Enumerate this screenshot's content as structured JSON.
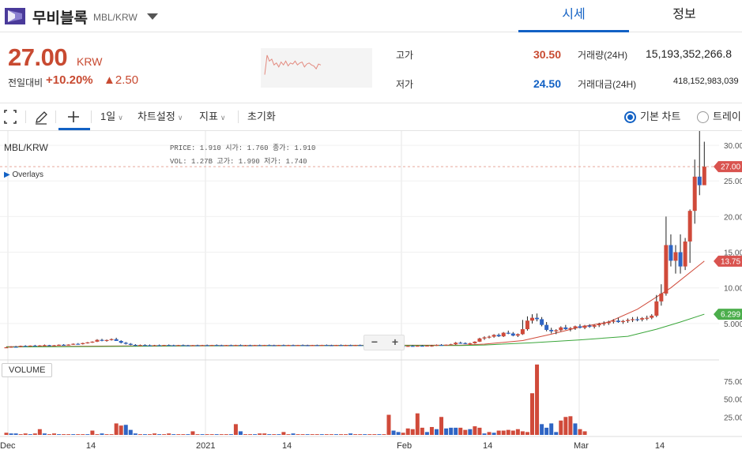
{
  "header": {
    "coin_name": "무비블록",
    "coin_pair": "MBL/KRW",
    "tabs": [
      {
        "label": "시세",
        "active": true
      },
      {
        "label": "정보",
        "active": false
      }
    ]
  },
  "summary": {
    "price": "27.00",
    "price_unit": "KRW",
    "change_label": "전일대비",
    "change_pct": "+10.20%",
    "change_amount": "▲2.50",
    "high_label": "고가",
    "high_value": "30.50",
    "low_label": "저가",
    "low_value": "24.50",
    "volume_label": "거래량(24H)",
    "volume_value": "15,193,352,266.8",
    "amount_label": "거래대금(24H)",
    "amount_value": "418,152,983,039"
  },
  "toolbar": {
    "interval": "1일",
    "chart_settings": "차트설정",
    "indicators": "지표",
    "reset": "초기화",
    "basic_chart": "기본 차트",
    "tradingview": "트레이"
  },
  "chart": {
    "symbol": "MBL/KRW",
    "ohlc_line1": "PRICE: 1.910   시가: 1.760   종가: 1.910",
    "ohlc_line2": "VOL:  1.27B   고가: 1.990   저가: 1.740",
    "overlays_label": "Overlays",
    "volume_label": "VOLUME",
    "zoom_out": "−",
    "zoom_in": "+",
    "price_ticks": [
      "30.00",
      "25.00",
      "20.00",
      "15.00",
      "10.00",
      "5.000"
    ],
    "volume_ticks": [
      "75.00",
      "50.00",
      "25.00"
    ],
    "date_ticks": [
      "Dec",
      "14",
      "2021",
      "14",
      "Feb",
      "14",
      "Mar",
      "14"
    ],
    "last_price_tag": "27.00",
    "ma_red_tag": "13.75",
    "ma_green_tag": "6.299",
    "colors": {
      "up": "#d04a3a",
      "down": "#2f65c4",
      "ma_short": "#d04a3a",
      "ma_long": "#3aa63a",
      "accent": "#1261c4"
    }
  },
  "chart_data": {
    "type": "candlestick",
    "candles": [
      [
        1.6,
        1.7,
        1.55,
        1.66
      ],
      [
        1.66,
        1.8,
        1.6,
        1.74
      ],
      [
        1.74,
        1.85,
        1.7,
        1.7
      ],
      [
        1.7,
        1.9,
        1.68,
        1.86
      ],
      [
        1.86,
        1.95,
        1.78,
        1.8
      ],
      [
        1.8,
        1.92,
        1.75,
        1.9
      ],
      [
        1.9,
        2.0,
        1.82,
        1.84
      ],
      [
        1.84,
        1.96,
        1.8,
        1.92
      ],
      [
        1.92,
        2.05,
        1.88,
        1.96
      ],
      [
        1.96,
        2.0,
        1.85,
        1.88
      ],
      [
        1.88,
        1.98,
        1.82,
        1.94
      ],
      [
        1.94,
        2.06,
        1.9,
        2.02
      ],
      [
        2.02,
        2.1,
        1.95,
        1.98
      ],
      [
        1.98,
        2.08,
        1.92,
        2.05
      ],
      [
        2.05,
        2.2,
        2.0,
        2.15
      ],
      [
        2.15,
        2.25,
        2.05,
        2.1
      ],
      [
        2.1,
        2.3,
        2.05,
        2.25
      ],
      [
        2.25,
        2.4,
        2.18,
        2.35
      ],
      [
        2.35,
        2.5,
        2.28,
        2.45
      ],
      [
        2.45,
        2.8,
        2.4,
        2.7
      ],
      [
        2.7,
        2.85,
        2.5,
        2.6
      ],
      [
        2.6,
        2.75,
        2.45,
        2.68
      ],
      [
        2.68,
        2.9,
        2.6,
        2.8
      ],
      [
        2.8,
        3.0,
        2.6,
        2.55
      ],
      [
        2.55,
        2.65,
        2.2,
        2.3
      ],
      [
        2.3,
        2.4,
        2.05,
        2.15
      ],
      [
        2.15,
        2.25,
        1.95,
        2.0
      ],
      [
        2.0,
        2.1,
        1.85,
        1.92
      ],
      [
        1.92,
        2.05,
        1.85,
        1.98
      ],
      [
        1.98,
        2.08,
        1.9,
        1.95
      ],
      [
        1.95,
        2.05,
        1.88,
        1.9
      ],
      [
        1.9,
        2.0,
        1.82,
        1.96
      ],
      [
        1.96,
        2.05,
        1.9,
        1.92
      ],
      [
        1.92,
        2.0,
        1.85,
        1.98
      ],
      [
        1.98,
        2.06,
        1.92,
        1.95
      ],
      [
        1.95,
        2.02,
        1.88,
        1.93
      ],
      [
        1.93,
        2.0,
        1.86,
        1.97
      ],
      [
        1.97,
        2.05,
        1.9,
        1.94
      ],
      [
        1.94,
        2.0,
        1.86,
        1.9
      ],
      [
        1.9,
        1.98,
        1.84,
        1.95
      ],
      [
        1.95,
        2.02,
        1.88,
        1.92
      ],
      [
        1.92,
        2.0,
        1.85,
        1.96
      ],
      [
        1.96,
        2.04,
        1.9,
        1.93
      ],
      [
        1.93,
        2.0,
        1.86,
        1.98
      ],
      [
        1.98,
        2.06,
        1.92,
        1.95
      ],
      [
        1.95,
        2.02,
        1.88,
        1.91
      ],
      [
        1.91,
        1.99,
        1.85,
        1.96
      ],
      [
        1.96,
        2.03,
        1.9,
        1.94
      ],
      [
        1.94,
        2.01,
        1.87,
        1.97
      ],
      [
        1.97,
        2.05,
        1.91,
        1.93
      ],
      [
        1.93,
        2.0,
        1.86,
        1.95
      ],
      [
        1.95,
        2.02,
        1.89,
        1.92
      ],
      [
        1.92,
        2.0,
        1.85,
        1.96
      ],
      [
        1.96,
        2.03,
        1.9,
        1.94
      ],
      [
        1.94,
        2.0,
        1.86,
        1.98
      ],
      [
        1.98,
        2.05,
        1.92,
        1.95
      ],
      [
        1.95,
        2.02,
        1.88,
        1.93
      ],
      [
        1.93,
        2.0,
        1.86,
        1.97
      ],
      [
        1.97,
        2.04,
        1.9,
        1.94
      ],
      [
        1.94,
        2.01,
        1.87,
        1.96
      ],
      [
        1.96,
        2.03,
        1.9,
        1.93
      ],
      [
        1.93,
        2.0,
        1.86,
        1.97
      ],
      [
        1.97,
        2.05,
        1.91,
        1.95
      ],
      [
        1.95,
        2.02,
        1.88,
        1.92
      ],
      [
        1.92,
        2.0,
        1.85,
        1.96
      ],
      [
        1.96,
        2.03,
        1.9,
        1.94
      ],
      [
        1.94,
        2.01,
        1.87,
        1.98
      ],
      [
        1.98,
        2.05,
        1.92,
        1.95
      ],
      [
        1.95,
        2.02,
        1.88,
        1.93
      ],
      [
        1.93,
        2.0,
        1.86,
        1.97
      ],
      [
        1.97,
        2.05,
        1.91,
        1.94
      ],
      [
        1.94,
        2.01,
        1.87,
        1.96
      ],
      [
        1.96,
        2.03,
        1.9,
        1.93
      ],
      [
        1.93,
        2.0,
        1.86,
        1.97
      ],
      [
        1.97,
        2.04,
        1.9,
        1.95
      ],
      [
        1.95,
        2.02,
        1.88,
        1.92
      ],
      [
        1.92,
        2.0,
        1.85,
        1.96
      ],
      [
        1.96,
        2.03,
        1.9,
        1.94
      ],
      [
        1.94,
        2.01,
        1.87,
        1.9
      ],
      [
        1.9,
        1.98,
        1.84,
        1.86
      ],
      [
        1.86,
        1.94,
        1.8,
        1.82
      ],
      [
        1.82,
        1.9,
        1.76,
        1.88
      ],
      [
        1.88,
        1.96,
        1.82,
        1.85
      ],
      [
        1.85,
        1.92,
        1.78,
        1.8
      ],
      [
        1.8,
        1.88,
        1.74,
        1.86
      ],
      [
        1.86,
        1.94,
        1.8,
        1.83
      ],
      [
        1.83,
        1.9,
        1.76,
        1.88
      ],
      [
        1.88,
        1.96,
        1.82,
        1.84
      ],
      [
        1.84,
        1.92,
        1.78,
        1.9
      ],
      [
        1.9,
        1.99,
        1.74,
        1.91
      ],
      [
        1.91,
        2.05,
        1.85,
        2.0
      ],
      [
        2.0,
        2.1,
        1.92,
        1.96
      ],
      [
        1.96,
        2.05,
        1.88,
        2.02
      ],
      [
        2.02,
        2.15,
        1.96,
        2.08
      ],
      [
        2.08,
        2.4,
        2.0,
        2.3
      ],
      [
        2.3,
        2.45,
        2.15,
        2.25
      ],
      [
        2.25,
        2.35,
        2.1,
        2.15
      ],
      [
        2.15,
        2.3,
        2.05,
        2.22
      ],
      [
        2.22,
        2.5,
        2.15,
        2.45
      ],
      [
        2.45,
        3.0,
        2.4,
        2.9
      ],
      [
        2.9,
        3.2,
        2.7,
        3.05
      ],
      [
        3.05,
        3.3,
        2.9,
        3.15
      ],
      [
        3.15,
        3.5,
        3.0,
        3.4
      ],
      [
        3.4,
        3.6,
        3.1,
        3.2
      ],
      [
        3.2,
        3.8,
        3.1,
        3.7
      ],
      [
        3.7,
        4.0,
        3.5,
        3.6
      ],
      [
        3.6,
        3.8,
        3.2,
        3.3
      ],
      [
        3.3,
        3.6,
        3.1,
        3.5
      ],
      [
        3.5,
        5.5,
        3.4,
        4.2
      ],
      [
        4.2,
        6.0,
        4.0,
        5.4
      ],
      [
        5.4,
        6.3,
        5.0,
        5.8
      ],
      [
        5.8,
        6.4,
        5.3,
        5.6
      ],
      [
        5.6,
        5.9,
        4.6,
        4.8
      ],
      [
        4.8,
        5.2,
        3.9,
        4.1
      ],
      [
        4.1,
        4.4,
        3.6,
        3.9
      ],
      [
        3.9,
        4.2,
        3.5,
        4.05
      ],
      [
        4.05,
        4.6,
        3.9,
        4.45
      ],
      [
        4.45,
        4.8,
        4.1,
        4.2
      ],
      [
        4.2,
        4.5,
        3.9,
        4.35
      ],
      [
        4.35,
        4.7,
        4.1,
        4.6
      ],
      [
        4.6,
        4.9,
        4.3,
        4.4
      ],
      [
        4.4,
        4.8,
        4.2,
        4.7
      ],
      [
        4.7,
        4.9,
        4.4,
        4.55
      ],
      [
        4.55,
        4.85,
        4.3,
        4.75
      ],
      [
        4.75,
        5.1,
        4.5,
        4.95
      ],
      [
        4.95,
        5.3,
        4.7,
        5.05
      ],
      [
        5.05,
        5.4,
        4.8,
        5.25
      ],
      [
        5.25,
        5.6,
        5.0,
        5.4
      ],
      [
        5.4,
        5.8,
        5.1,
        5.2
      ],
      [
        5.2,
        5.5,
        4.95,
        5.35
      ],
      [
        5.35,
        5.7,
        5.1,
        5.5
      ],
      [
        5.5,
        5.9,
        5.2,
        5.6
      ],
      [
        5.6,
        5.95,
        5.3,
        5.55
      ],
      [
        5.55,
        5.9,
        5.3,
        5.75
      ],
      [
        5.75,
        6.1,
        5.45,
        5.8
      ],
      [
        5.8,
        6.3,
        5.6,
        6.1
      ],
      [
        6.1,
        9.0,
        5.9,
        8.1
      ],
      [
        8.1,
        10.5,
        7.5,
        9.2
      ],
      [
        9.2,
        20.0,
        8.9,
        16.0
      ],
      [
        16.0,
        17.5,
        13.0,
        13.8
      ],
      [
        13.8,
        16.0,
        12.0,
        15.0
      ],
      [
        15.0,
        17.5,
        12.0,
        13.0
      ],
      [
        13.0,
        17.0,
        12.5,
        16.5
      ],
      [
        16.5,
        21.0,
        13.5,
        20.8
      ],
      [
        20.8,
        28.0,
        19.0,
        25.6
      ],
      [
        25.6,
        32.0,
        23.0,
        24.4
      ],
      [
        24.4,
        30.5,
        24.5,
        27.0
      ]
    ],
    "volume": [
      [
        3,
        "u"
      ],
      [
        2,
        "d"
      ],
      [
        2,
        "d"
      ],
      [
        1,
        "u"
      ],
      [
        2,
        "u"
      ],
      [
        1,
        "d"
      ],
      [
        2,
        "u"
      ],
      [
        8,
        "u"
      ],
      [
        2,
        "d"
      ],
      [
        1,
        "u"
      ],
      [
        2,
        "u"
      ],
      [
        1,
        "d"
      ],
      [
        1,
        "u"
      ],
      [
        1,
        "u"
      ],
      [
        1,
        "d"
      ],
      [
        1,
        "u"
      ],
      [
        1,
        "u"
      ],
      [
        1,
        "d"
      ],
      [
        6,
        "u"
      ],
      [
        1,
        "u"
      ],
      [
        2,
        "d"
      ],
      [
        1,
        "u"
      ],
      [
        1,
        "u"
      ],
      [
        16,
        "u"
      ],
      [
        13,
        "u"
      ],
      [
        14,
        "d"
      ],
      [
        7,
        "d"
      ],
      [
        2,
        "d"
      ],
      [
        1,
        "u"
      ],
      [
        1,
        "d"
      ],
      [
        1,
        "u"
      ],
      [
        2,
        "u"
      ],
      [
        1,
        "d"
      ],
      [
        1,
        "u"
      ],
      [
        2,
        "u"
      ],
      [
        1,
        "d"
      ],
      [
        1,
        "u"
      ],
      [
        1,
        "u"
      ],
      [
        1,
        "d"
      ],
      [
        5,
        "u"
      ],
      [
        1,
        "u"
      ],
      [
        1,
        "d"
      ],
      [
        1,
        "u"
      ],
      [
        1,
        "u"
      ],
      [
        1,
        "d"
      ],
      [
        1,
        "u"
      ],
      [
        1,
        "u"
      ],
      [
        1,
        "d"
      ],
      [
        15,
        "u"
      ],
      [
        5,
        "d"
      ],
      [
        1,
        "u"
      ],
      [
        1,
        "u"
      ],
      [
        1,
        "d"
      ],
      [
        2,
        "u"
      ],
      [
        2,
        "u"
      ],
      [
        1,
        "d"
      ],
      [
        1,
        "u"
      ],
      [
        1,
        "d"
      ],
      [
        4,
        "u"
      ],
      [
        1,
        "u"
      ],
      [
        2,
        "d"
      ],
      [
        1,
        "u"
      ],
      [
        1,
        "u"
      ],
      [
        1,
        "d"
      ],
      [
        1,
        "u"
      ],
      [
        1,
        "u"
      ],
      [
        1,
        "d"
      ],
      [
        1,
        "u"
      ],
      [
        1,
        "u"
      ],
      [
        1,
        "d"
      ],
      [
        1,
        "u"
      ],
      [
        1,
        "u"
      ],
      [
        2,
        "d"
      ],
      [
        1,
        "u"
      ],
      [
        1,
        "u"
      ],
      [
        1,
        "d"
      ],
      [
        1,
        "u"
      ],
      [
        1,
        "u"
      ],
      [
        1,
        "d"
      ],
      [
        1,
        "u"
      ],
      [
        28,
        "u"
      ],
      [
        6,
        "d"
      ],
      [
        4,
        "d"
      ],
      [
        3,
        "u"
      ],
      [
        9,
        "u"
      ],
      [
        8,
        "u"
      ],
      [
        30,
        "u"
      ],
      [
        10,
        "u"
      ],
      [
        4,
        "d"
      ],
      [
        11,
        "u"
      ],
      [
        8,
        "d"
      ],
      [
        25,
        "u"
      ],
      [
        9,
        "d"
      ],
      [
        10,
        "d"
      ],
      [
        10,
        "d"
      ],
      [
        10,
        "u"
      ],
      [
        7,
        "u"
      ],
      [
        8,
        "d"
      ],
      [
        12,
        "u"
      ],
      [
        10,
        "u"
      ],
      [
        2,
        "d"
      ],
      [
        4,
        "u"
      ],
      [
        3,
        "d"
      ],
      [
        6,
        "u"
      ],
      [
        6,
        "u"
      ],
      [
        7,
        "u"
      ],
      [
        6,
        "u"
      ],
      [
        8,
        "u"
      ],
      [
        5,
        "u"
      ],
      [
        4,
        "u"
      ],
      [
        58,
        "u"
      ],
      [
        98,
        "u"
      ],
      [
        15,
        "d"
      ],
      [
        10,
        "d"
      ],
      [
        16,
        "d"
      ],
      [
        4,
        "d"
      ],
      [
        20,
        "u"
      ],
      [
        25,
        "u"
      ],
      [
        26,
        "u"
      ],
      [
        16,
        "d"
      ],
      [
        8,
        "u"
      ],
      [
        5,
        "u"
      ]
    ],
    "ma_short": [
      [
        40,
        1.9
      ],
      [
        80,
        1.95
      ],
      [
        95,
        1.95
      ],
      [
        100,
        2.1
      ],
      [
        108,
        2.6
      ],
      [
        114,
        3.5
      ],
      [
        120,
        4.5
      ],
      [
        126,
        5.2
      ],
      [
        132,
        7.0
      ],
      [
        139,
        10.0
      ],
      [
        146,
        13.75
      ]
    ],
    "ma_long": [
      [
        40,
        1.85
      ],
      [
        80,
        1.9
      ],
      [
        95,
        1.92
      ],
      [
        100,
        1.98
      ],
      [
        110,
        2.3
      ],
      [
        120,
        2.7
      ],
      [
        130,
        3.2
      ],
      [
        136,
        4.2
      ],
      [
        141,
        5.2
      ],
      [
        146,
        6.299
      ]
    ],
    "price_ylim": [
      0,
      32
    ],
    "volume_ylim": [
      0,
      100
    ]
  },
  "sparkline": [
    2.0,
    3.0,
    2.7,
    2.8,
    2.5,
    2.6,
    2.4,
    2.65,
    2.5,
    2.7,
    2.45,
    2.6,
    2.55,
    2.7,
    2.5,
    2.6,
    2.65,
    2.4,
    2.55,
    2.6,
    2.5,
    2.45,
    2.3,
    2.55,
    2.5
  ]
}
